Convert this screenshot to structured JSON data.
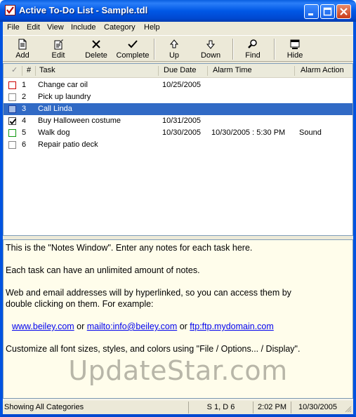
{
  "window": {
    "title": "Active To-Do List - Sample.tdl"
  },
  "menu": [
    "File",
    "Edit",
    "View",
    "Include",
    "Category",
    "Help"
  ],
  "toolbar": {
    "add": "Add",
    "edit": "Edit",
    "delete": "Delete",
    "complete": "Complete",
    "up": "Up",
    "down": "Down",
    "find": "Find",
    "hide": "Hide"
  },
  "columns": {
    "check": "✓",
    "num": "#",
    "task": "Task",
    "due": "Due Date",
    "alarm_time": "Alarm Time",
    "alarm_action": "Alarm Action"
  },
  "tasks": [
    {
      "num": "1",
      "task": "Change car oil",
      "due": "10/25/2005",
      "alarm_time": "",
      "alarm_action": "",
      "checked": false,
      "box_color": "#cc0000"
    },
    {
      "num": "2",
      "task": "Pick up laundry",
      "due": "",
      "alarm_time": "",
      "alarm_action": "",
      "checked": false,
      "box_color": "#888888"
    },
    {
      "num": "3",
      "task": "Call Linda",
      "due": "",
      "alarm_time": "",
      "alarm_action": "",
      "checked": false,
      "box_color": "#3366cc",
      "selected": true
    },
    {
      "num": "4",
      "task": "Buy Halloween costume",
      "due": "10/31/2005",
      "alarm_time": "",
      "alarm_action": "",
      "checked": true,
      "box_color": "#444444"
    },
    {
      "num": "5",
      "task": "Walk dog",
      "due": "10/30/2005",
      "alarm_time": "10/30/2005 : 5:30 PM",
      "alarm_action": "Sound",
      "checked": false,
      "box_color": "#119911"
    },
    {
      "num": "6",
      "task": "Repair patio deck",
      "due": "",
      "alarm_time": "",
      "alarm_action": "",
      "checked": false,
      "box_color": "#888888"
    }
  ],
  "notes": {
    "line1": "This is the \"Notes Window\".  Enter any notes for each task here.",
    "line2": "Each task can have an unlimited amount of notes.",
    "line3a": "Web and email addresses will by hyperlinked, so you can access them by",
    "line3b": "double clicking on them.  For example:",
    "link1": "www.beiley.com",
    "or1": " or ",
    "link2": "mailto:info@beiley.com",
    "or2": " or ",
    "link3": "ftp:ftp.mydomain.com",
    "line5": "Customize all font sizes, styles, and colors using \"File / Options... / Display\"."
  },
  "watermark": "UpdateStar.com",
  "status": {
    "categories": "Showing All Categories",
    "counts": "S 1, D 6",
    "time": "2:02 PM",
    "date": "10/30/2005"
  },
  "colors": {
    "title_bar": "#0058e6",
    "selection": "#316ac5",
    "notes_bg": "#fffdeb",
    "link": "#0000ee"
  }
}
